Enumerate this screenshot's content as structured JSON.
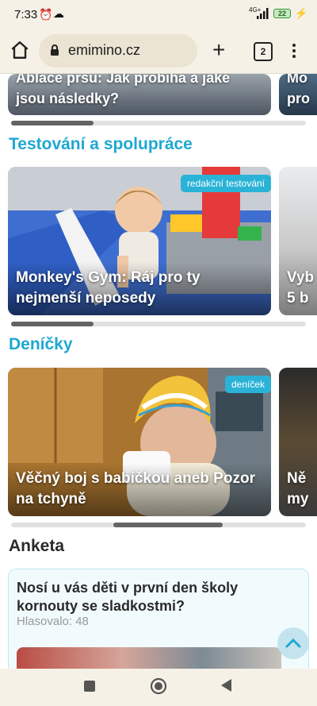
{
  "status": {
    "time": "7:33",
    "network": "4G+",
    "battery": "22"
  },
  "browser": {
    "url": "emimino.cz",
    "tab_count": "2"
  },
  "cards_row0": {
    "left_title": "Ablace prsu: Jak probíhá a jaké jsou následky?",
    "right_title": "Mo pro"
  },
  "section_testing": {
    "heading": "Testování a spolupráce",
    "card": {
      "tag": "redakční testování",
      "title": "Monkey's Gym: Ráj pro ty nejmenší neposedy"
    },
    "next_card_title": "Vyb 5 b",
    "scroll_fraction": 0.28
  },
  "section_diaries": {
    "heading": "Deníčky",
    "card": {
      "tag": "deníček",
      "title": "Věčný boj s babičkou aneb Pozor na tchyně"
    },
    "next_card_title": "Ně my",
    "scroll_fraction": 0.55
  },
  "poll": {
    "heading": "Anketa",
    "question": "Nosí u vás děti v první den školy kornouty se sladkostmi?",
    "votes": "Hlasovalo: 48"
  },
  "colors": {
    "accent": "#1fa8d2",
    "tag": "#2ab3d6",
    "chrome": "#f6f1e6"
  },
  "icons": [
    "home-icon",
    "lock-icon",
    "plus-icon",
    "tabs-icon",
    "more-vert-icon",
    "alarm-icon",
    "cloud-icon",
    "signal-icon",
    "battery-icon",
    "charging-icon",
    "scroll-up-icon",
    "nav-square-icon",
    "nav-home-icon",
    "nav-back-icon"
  ]
}
